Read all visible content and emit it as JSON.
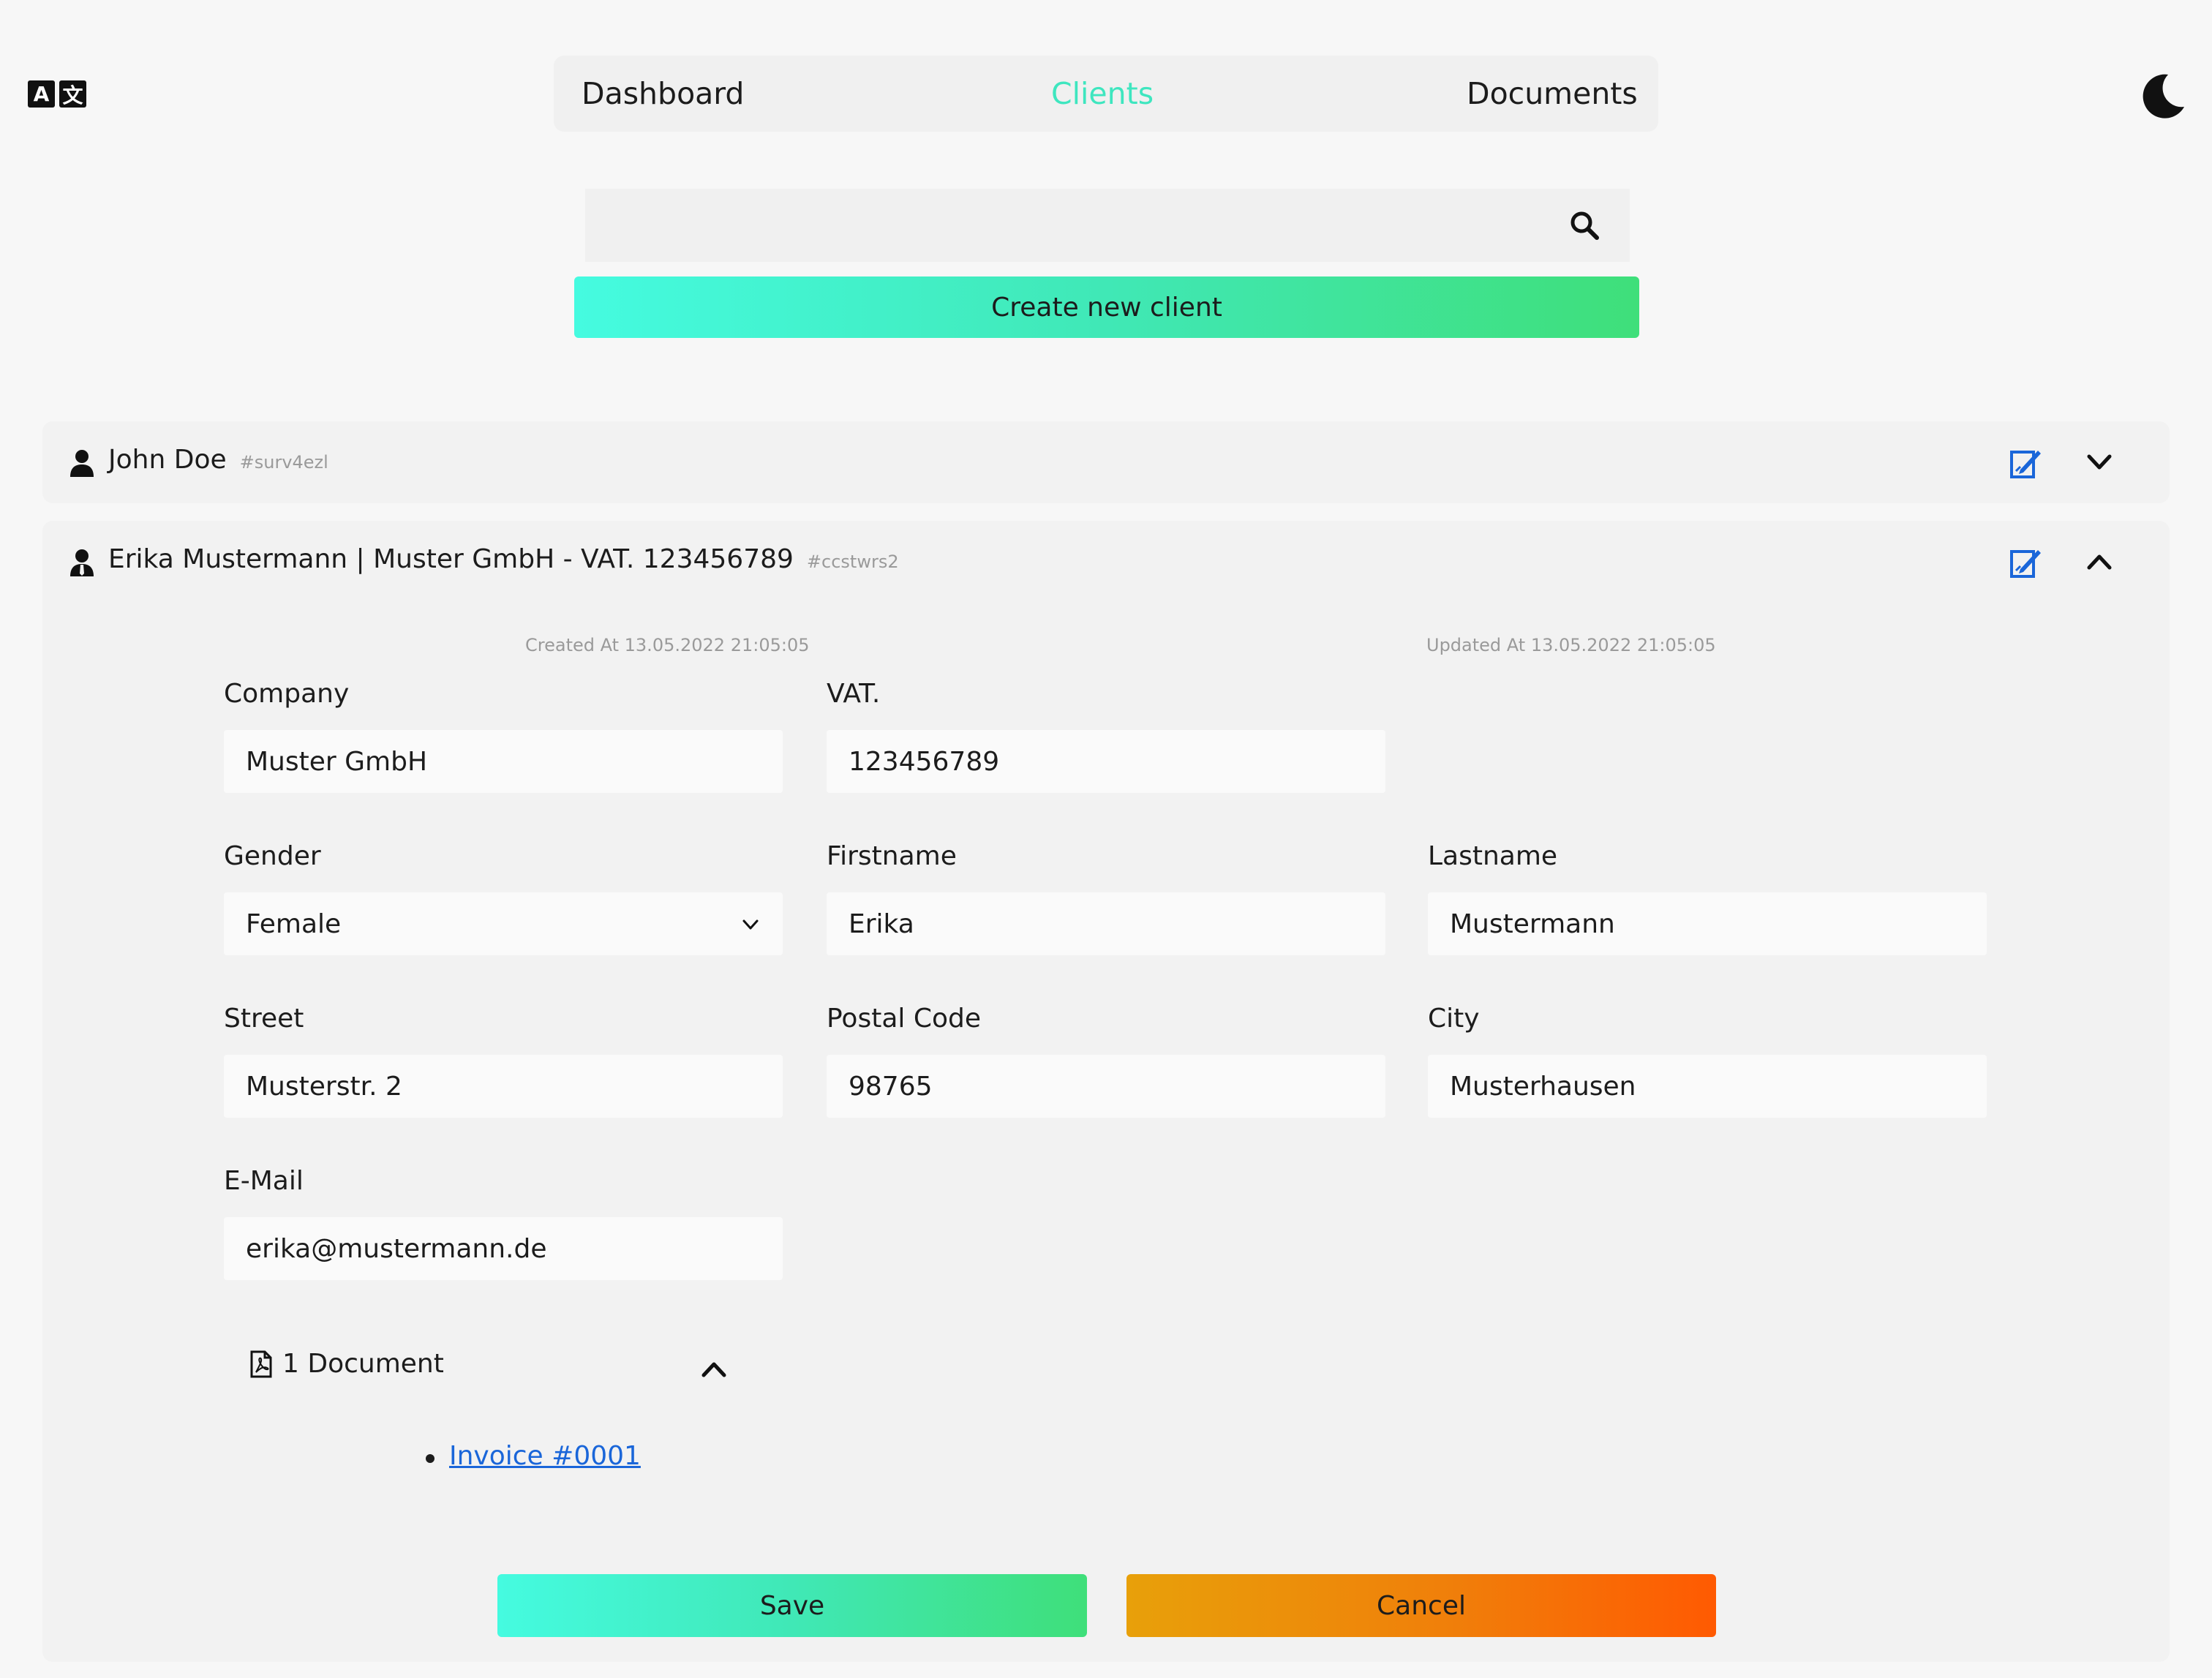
{
  "nav": {
    "items": [
      {
        "label": "Dashboard",
        "active": false
      },
      {
        "label": "Clients",
        "active": true
      },
      {
        "label": "Documents",
        "active": false
      }
    ],
    "active_color": "#3ee6bf"
  },
  "header": {
    "language_icon": "translate-icon",
    "theme_icon": "moon-icon"
  },
  "search": {
    "value": "",
    "placeholder": "",
    "icon": "search-icon"
  },
  "create_button": {
    "label": "Create new client"
  },
  "clients": [
    {
      "name": "John Doe",
      "id": "#surv4ezl",
      "expanded": false
    },
    {
      "name": "Erika Mustermann | Muster GmbH - VAT. 123456789",
      "id": "#ccstwrs2",
      "expanded": true,
      "created_at": "Created At 13.05.2022 21:05:05",
      "updated_at": "Updated At 13.05.2022 21:05:05",
      "fields": {
        "company": {
          "label": "Company",
          "value": "Muster GmbH"
        },
        "vat": {
          "label": "VAT.",
          "value": "123456789"
        },
        "gender": {
          "label": "Gender",
          "value": "Female"
        },
        "firstname": {
          "label": "Firstname",
          "value": "Erika"
        },
        "lastname": {
          "label": "Lastname",
          "value": "Mustermann"
        },
        "street": {
          "label": "Street",
          "value": "Musterstr. 2"
        },
        "postal_code": {
          "label": "Postal Code",
          "value": "98765"
        },
        "city": {
          "label": "City",
          "value": "Musterhausen"
        },
        "email": {
          "label": "E-Mail",
          "value": "erika@mustermann.de"
        }
      },
      "documents": {
        "summary": "1 Document",
        "items": [
          "Invoice #0001"
        ]
      },
      "save_label": "Save",
      "cancel_label": "Cancel"
    }
  ],
  "colors": {
    "primary_gradient": [
      "#45fbe0",
      "#3fdf7a"
    ],
    "cancel_gradient": [
      "#e8a00a",
      "#ff5a02"
    ],
    "link": "#1a66d9",
    "edit_icon": "#1a66d9"
  }
}
